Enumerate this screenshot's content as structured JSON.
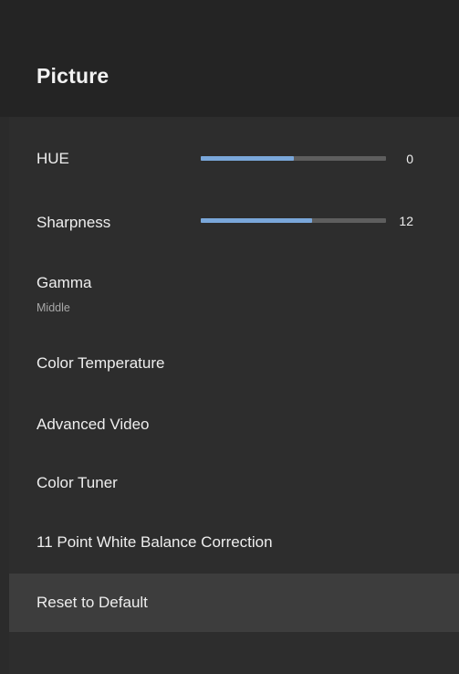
{
  "header": {
    "title": "Picture"
  },
  "items": [
    {
      "label": "HUE",
      "value": "0",
      "level": 0.5
    },
    {
      "label": "Sharpness",
      "value": "12",
      "level": 0.6
    },
    {
      "label": "Gamma",
      "sub": "Middle"
    },
    {
      "label": "Color Temperature"
    },
    {
      "label": "Advanced Video"
    },
    {
      "label": "Color Tuner"
    },
    {
      "label": "11 Point White Balance Correction"
    },
    {
      "label": "Reset to Default",
      "selected": true
    }
  ],
  "colors": {
    "background": "#2b2b2b",
    "header": "#242424",
    "slider_fill": "#7aa7da",
    "slider_track": "#5e5e5e",
    "selected_row": "#3d3d3d"
  }
}
